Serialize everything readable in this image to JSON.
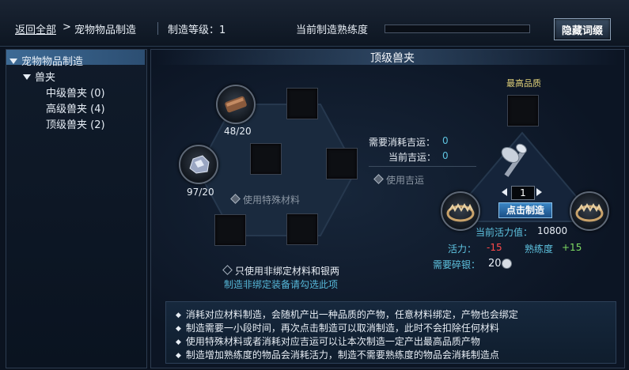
{
  "header": {
    "back_label": "返回全部",
    "crumb_arrow": ">",
    "crumb_current": "宠物物品制造",
    "level_label": "制造等级：1",
    "proficiency_label": "当前制造熟练度",
    "proficiency_progress": 0,
    "hide_button": "隐藏词缀"
  },
  "sidebar": {
    "root": "宠物物品制造",
    "group": "兽夹",
    "items": [
      {
        "label": "中级兽夹 (0)"
      },
      {
        "label": "高级兽夹 (4)"
      },
      {
        "label": "顶级兽夹 (2)"
      }
    ]
  },
  "main": {
    "title": "顶级兽夹",
    "material1_count": "48/20",
    "material2_count": "97/20",
    "special_material": "使用特殊材料",
    "need_luck_label": "需要消耗吉运：",
    "need_luck_value": "0",
    "cur_luck_label": "当前吉运：",
    "cur_luck_value": "0",
    "use_luck": "使用吉运",
    "best_quality": "最高品质",
    "quantity": "1",
    "craft_button": "点击制造",
    "vitality_current_label": "当前活力值：",
    "vitality_current_value": "10800",
    "vitality_label": "活力：",
    "vitality_value": "-15",
    "proficiency_label": "熟练度",
    "proficiency_value": "+15",
    "silver_label": "需要碎银：",
    "silver_value": "20",
    "unbound_option": "只使用非绑定材料和银两",
    "unbound_hint": "制造非绑定装备请勾选此项"
  },
  "notes": [
    "消耗对应材料制造，会随机产出一种品质的产物，任意材料绑定，产物也会绑定",
    "制造需要一小段时间，再次点击制造可以取消制造，此时不会扣除任何材料",
    "使用特殊材料或者消耗对应吉运可以让本次制造一定产出最高品质产物",
    "制造增加熟练度的物品会消耗活力，制造不需要熟练度的物品会消耗制造点"
  ]
}
